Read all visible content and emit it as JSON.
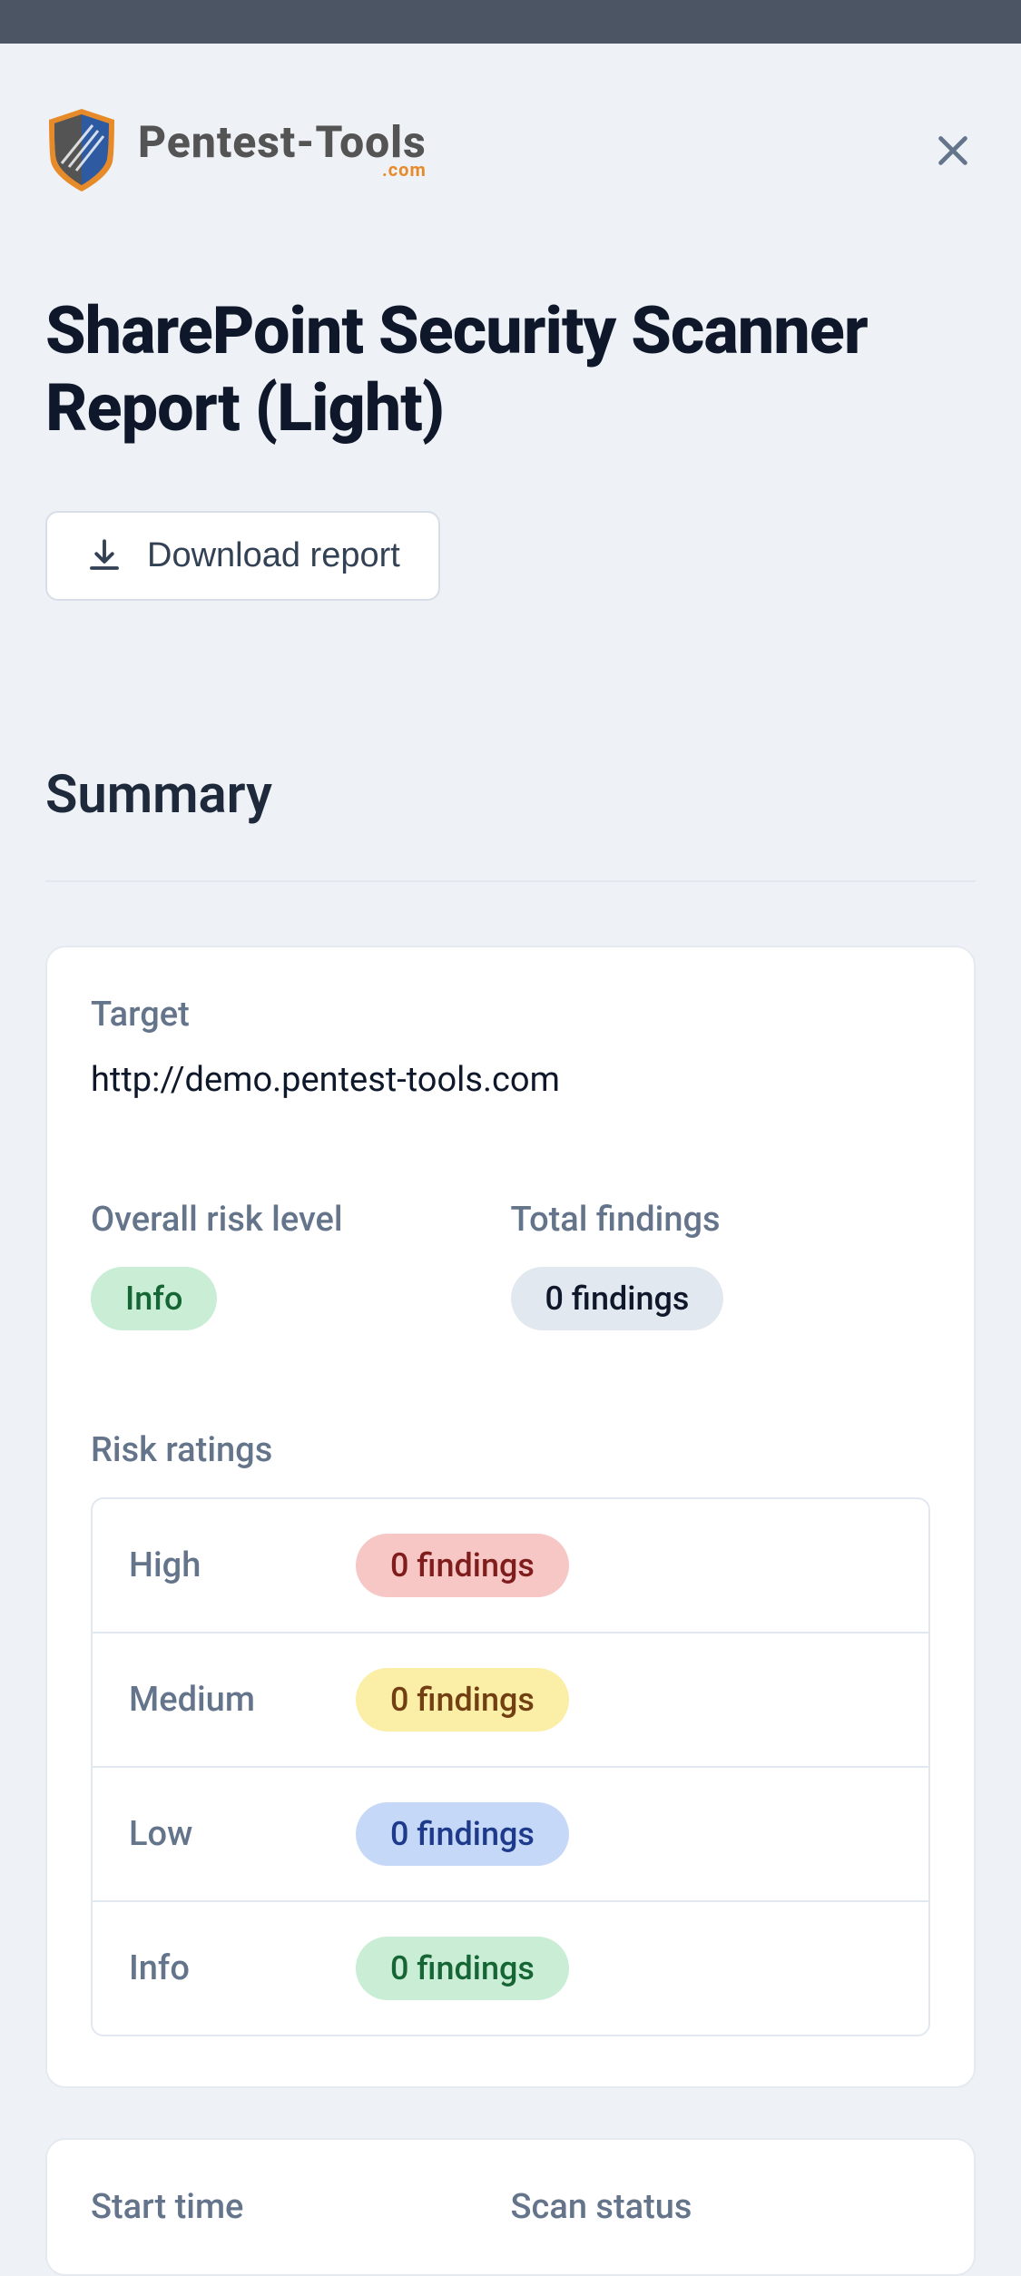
{
  "brand": {
    "main": "Pentest-Tools",
    "sub": ".com"
  },
  "title": "SharePoint Security Scanner Report (Light)",
  "download_label": "Download report",
  "summary_heading": "Summary",
  "target": {
    "label": "Target",
    "value": "http://demo.pentest-tools.com"
  },
  "overall_risk": {
    "label": "Overall risk level",
    "value": "Info"
  },
  "total_findings": {
    "label": "Total findings",
    "value": "0 findings"
  },
  "risk_ratings": {
    "label": "Risk ratings",
    "rows": [
      {
        "name": "High",
        "value": "0 findings",
        "class": "badge-red"
      },
      {
        "name": "Medium",
        "value": "0 findings",
        "class": "badge-yellow"
      },
      {
        "name": "Low",
        "value": "0 findings",
        "class": "badge-blue"
      },
      {
        "name": "Info",
        "value": "0 findings",
        "class": "badge-info-green"
      }
    ]
  },
  "start_time_label": "Start time",
  "scan_status_label": "Scan status"
}
